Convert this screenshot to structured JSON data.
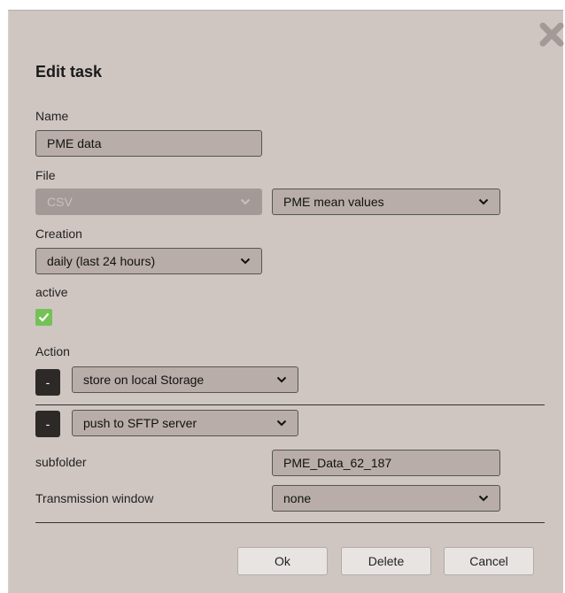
{
  "dialog": {
    "title": "Edit task",
    "close_icon": "close-x-icon"
  },
  "name": {
    "label": "Name",
    "value": "PME data"
  },
  "file": {
    "label": "File",
    "format_value": "CSV",
    "format_disabled": true,
    "source_value": "PME mean values"
  },
  "creation": {
    "label": "Creation",
    "value": "daily (last 24 hours)"
  },
  "active": {
    "label": "active",
    "checked": true
  },
  "action": {
    "label": "Action",
    "remove_label": "-",
    "items": [
      {
        "value": "store on local Storage"
      },
      {
        "value": "push to SFTP server"
      }
    ]
  },
  "sftp": {
    "subfolder_label": "subfolder",
    "subfolder_value": "PME_Data_62_187",
    "window_label": "Transmission window",
    "window_value": "none"
  },
  "buttons": {
    "ok": "Ok",
    "delete": "Delete",
    "cancel": "Cancel"
  },
  "colors": {
    "dialog_bg": "#cfc6c2",
    "field_bg": "#b8ada8",
    "checkbox_green": "#76c157",
    "button_dark": "#2d2926"
  }
}
